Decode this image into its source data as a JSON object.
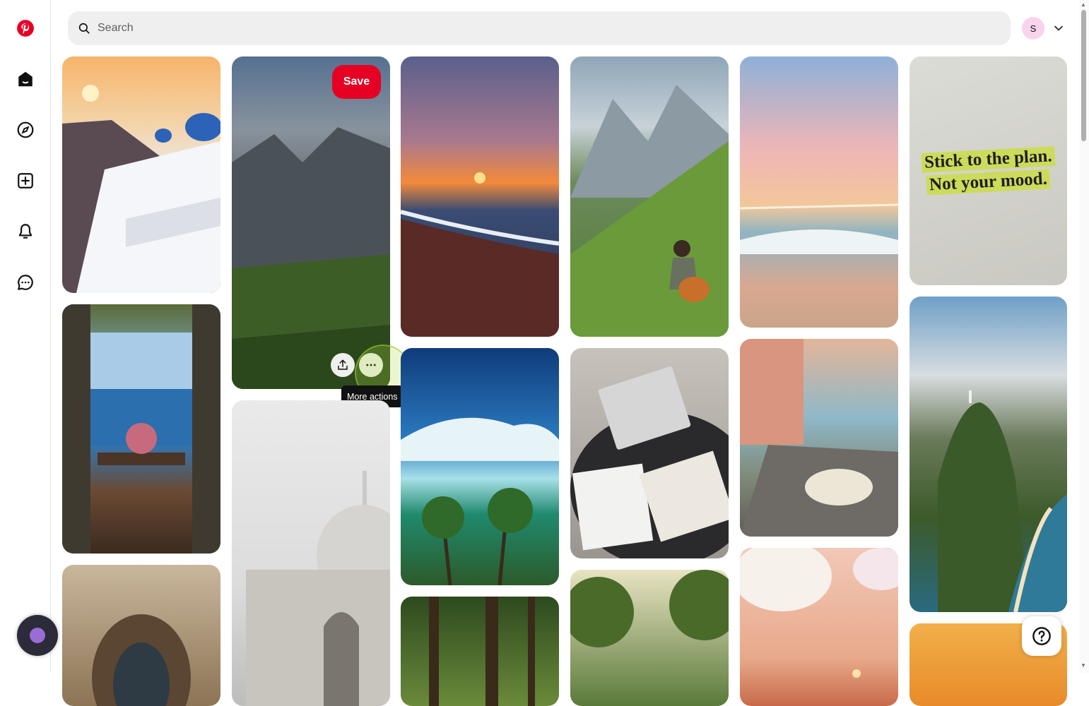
{
  "search": {
    "placeholder": "Search"
  },
  "account": {
    "initial": "S"
  },
  "sidebar": {
    "items": [
      {
        "name": "pinterest-logo-icon"
      },
      {
        "name": "home-icon"
      },
      {
        "name": "explore-icon"
      },
      {
        "name": "create-icon"
      },
      {
        "name": "notifications-icon"
      },
      {
        "name": "messages-icon"
      }
    ]
  },
  "hovered_pin": {
    "save_label": "Save",
    "tooltip": "More actions"
  },
  "quote_pin": {
    "line1": "Stick to the plan.",
    "line2": "Not your mood."
  },
  "colors": {
    "brand": "#e60023",
    "search_bg": "#efefef",
    "avatar_bg": "#f8d4ec"
  }
}
